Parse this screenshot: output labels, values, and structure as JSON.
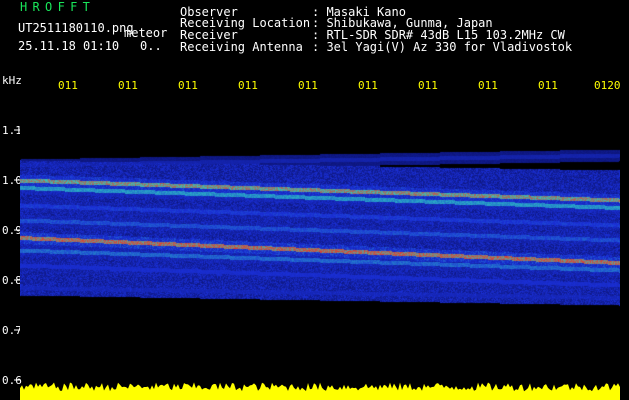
{
  "header": {
    "app_title": "HROFFT",
    "filename": "UT2511180110.png",
    "mode": "meteor",
    "timestamp": "25.11.18 01:10",
    "counter": "0.."
  },
  "station_info": [
    {
      "label": "Observer",
      "value": ": Masaki Kano"
    },
    {
      "label": "Receiving Location",
      "value": ": Shibukawa, Gunma, Japan"
    },
    {
      "label": "Receiver",
      "value": ": RTL-SDR SDR# 43dB L15 103.2MHz CW"
    },
    {
      "label": "Receiving Antenna",
      "value": ": 3el Yagi(V) Az 330 for Vladivostok"
    }
  ],
  "axes": {
    "unit_label": "kHz",
    "y_ticks": [
      "1.1",
      "1.0",
      "0.9",
      "0.8",
      "0.7",
      "0.6"
    ],
    "x_ticks": [
      "011",
      "011",
      "011",
      "011",
      "011",
      "011",
      "011",
      "011",
      "011",
      "0120"
    ]
  },
  "colors": {
    "background": "#000000",
    "title": "#19e65a",
    "text": "#ffffff",
    "time_ticks": "#ffff00",
    "signal_low": "#1a2fd6",
    "signal_mid": "#2dc9c0",
    "signal_high": "#e63a2a",
    "level": "#ffff00"
  },
  "chart_data": {
    "type": "heatmap",
    "xlabel": "",
    "ylabel": "kHz",
    "ylim": [
      0.6,
      1.1
    ],
    "bands": [
      {
        "start": 1.03,
        "end": 1.05,
        "intensity": 0.35
      },
      {
        "start": 1.0,
        "end": 0.96,
        "intensity": 0.95
      },
      {
        "start": 0.985,
        "end": 0.945,
        "intensity": 0.75
      },
      {
        "start": 0.95,
        "end": 0.91,
        "intensity": 0.55
      },
      {
        "start": 0.92,
        "end": 0.88,
        "intensity": 0.6
      },
      {
        "start": 0.885,
        "end": 0.835,
        "intensity": 1.0
      },
      {
        "start": 0.86,
        "end": 0.82,
        "intensity": 0.65
      },
      {
        "start": 0.83,
        "end": 0.79,
        "intensity": 0.5
      },
      {
        "start": 0.785,
        "end": 0.765,
        "intensity": 0.4
      }
    ],
    "signal_band_range": [
      0.77,
      1.04
    ],
    "level_range": [
      0,
      1
    ],
    "level_mean": 0.6
  }
}
